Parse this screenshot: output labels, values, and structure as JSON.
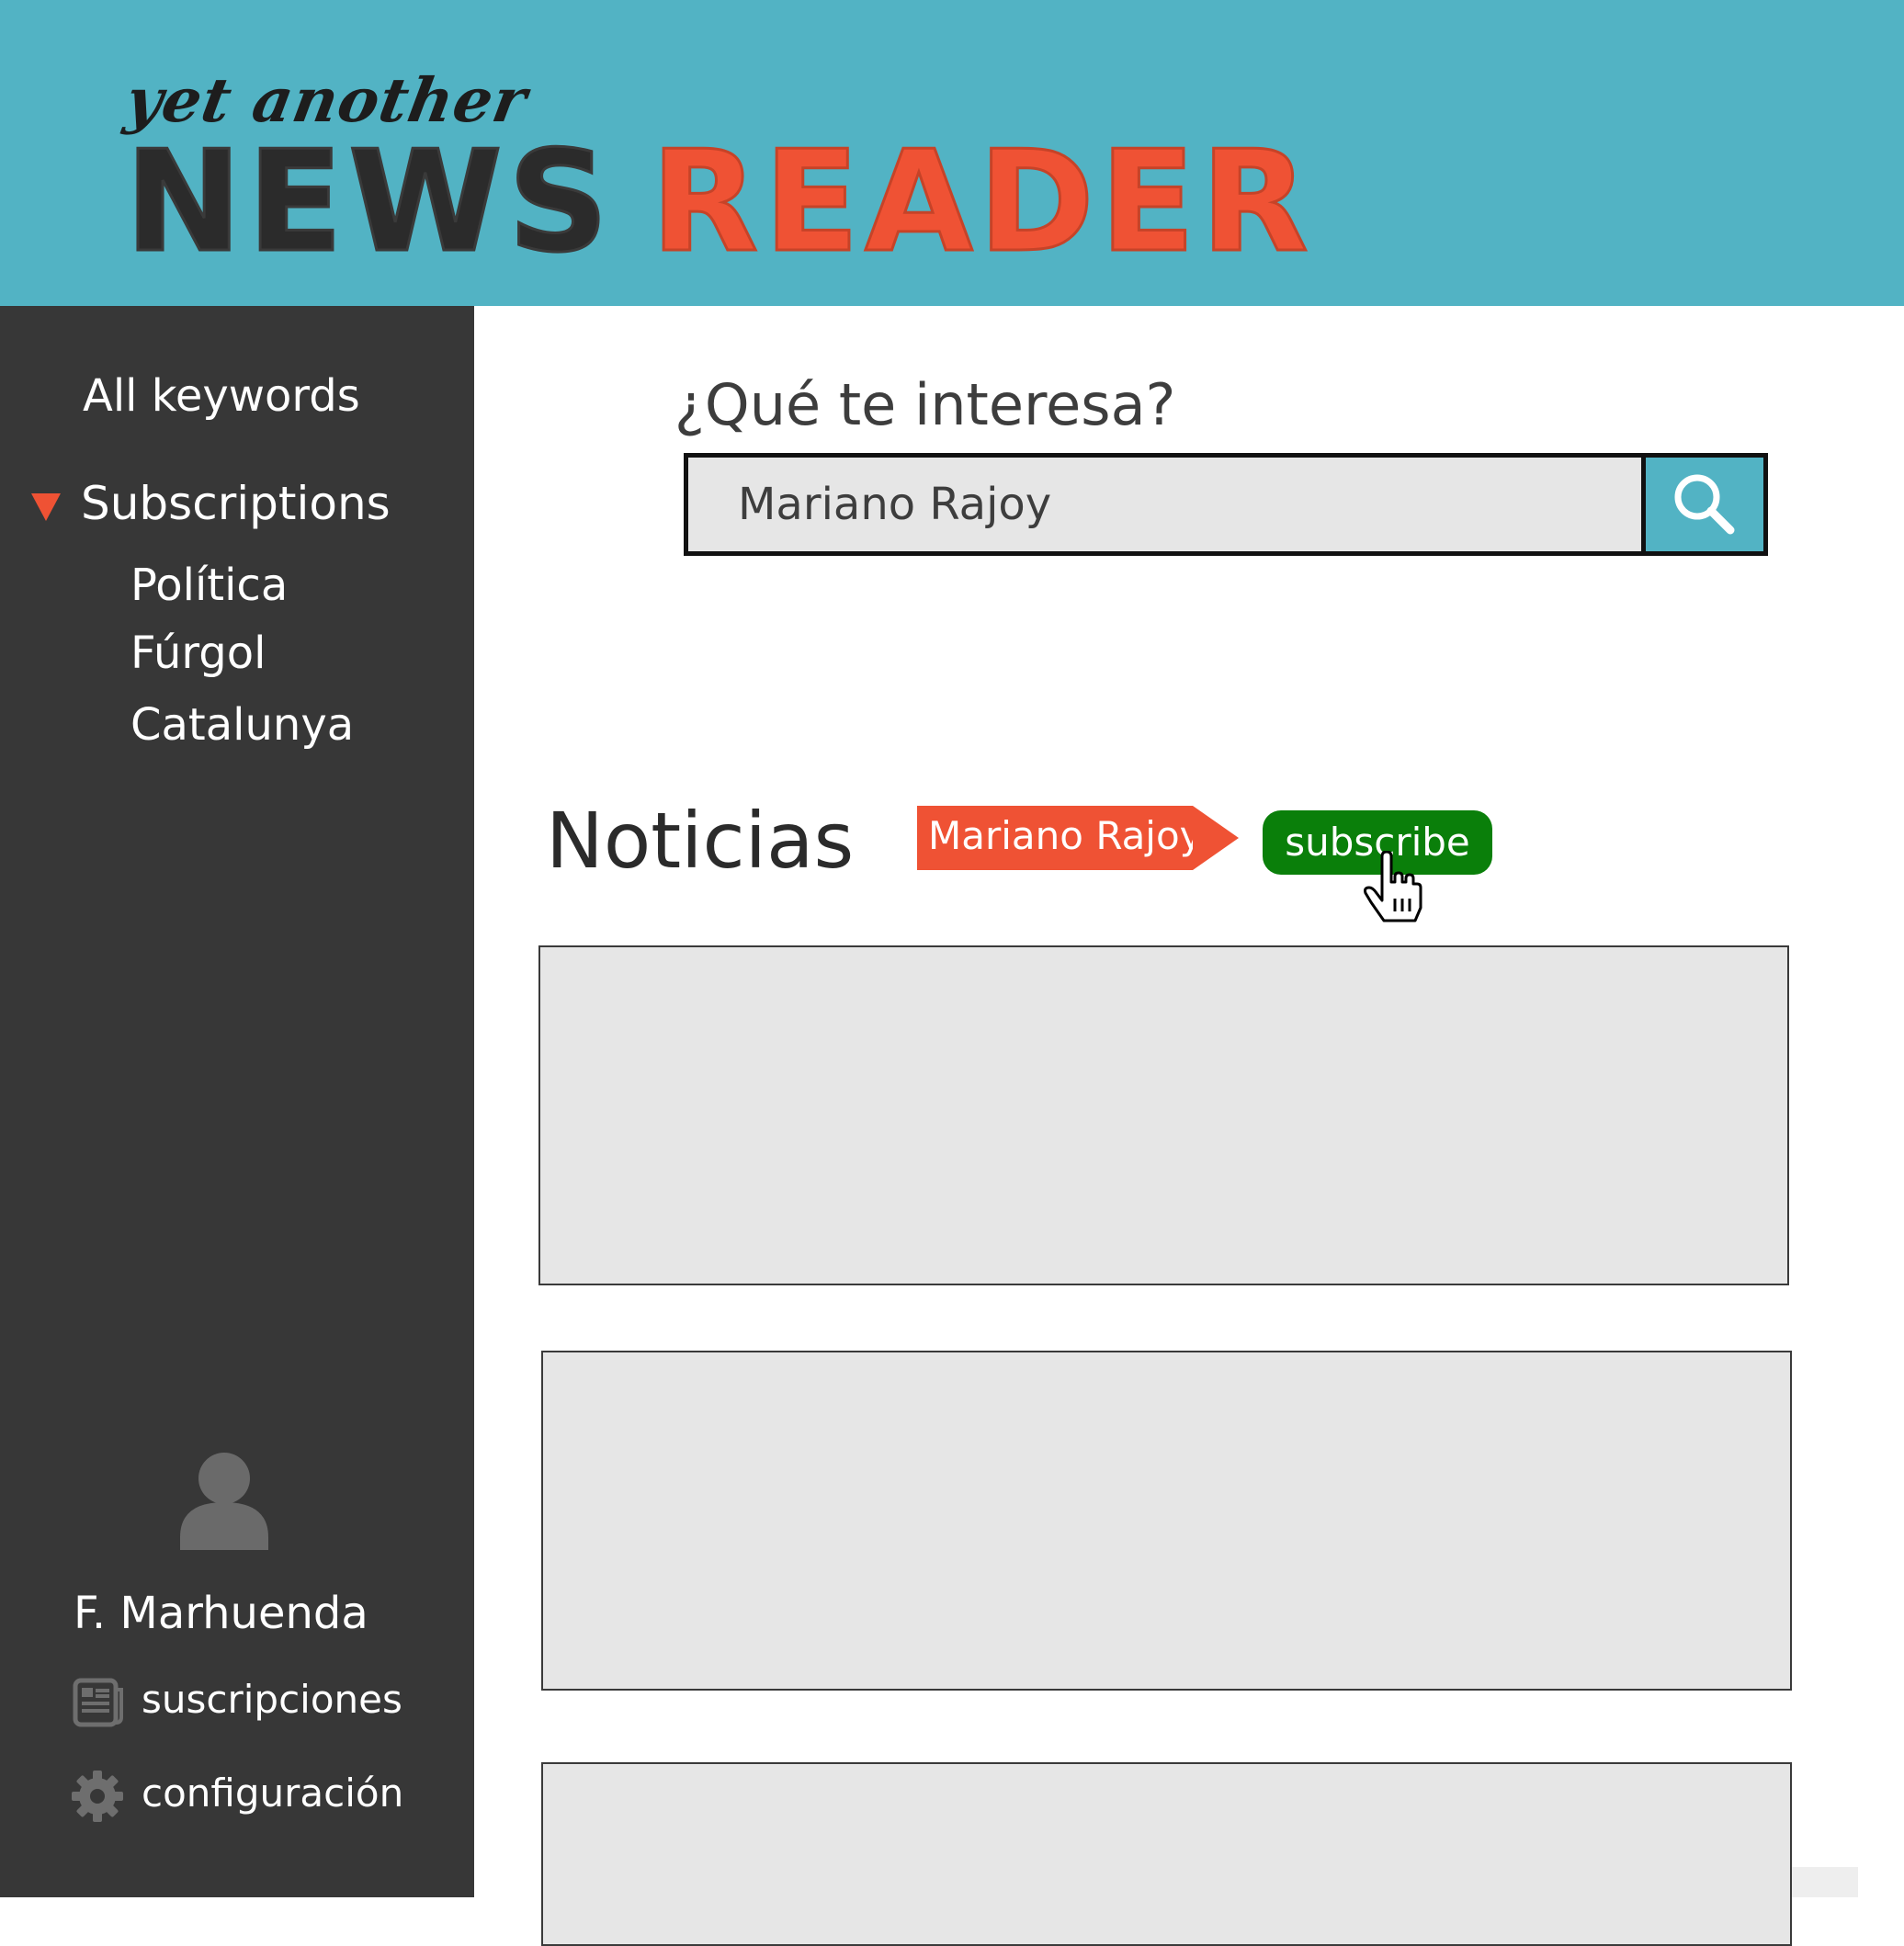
{
  "header": {
    "tagline": "yet another",
    "logo_word1": "NEWS",
    "logo_word2": "READER"
  },
  "sidebar": {
    "all_keywords": "All keywords",
    "subscriptions_label": "Subscriptions",
    "subscriptions": [
      "Política",
      "Fúrgol",
      "Catalunya"
    ],
    "user_name": "F. Marhuenda",
    "links": {
      "suscripciones": "suscripciones",
      "configuracion": "configuración"
    }
  },
  "search": {
    "title": "¿Qué te interesa?",
    "value": "Mariano Rajoy"
  },
  "news": {
    "title": "Noticias",
    "keyword_tag": "Mariano Rajoy",
    "subscribe_label": "subscribe"
  },
  "colors": {
    "header_bg": "#52b3c4",
    "sidebar_bg": "#373737",
    "accent": "#ef5234",
    "subscribe_green": "#0a7f0a"
  }
}
